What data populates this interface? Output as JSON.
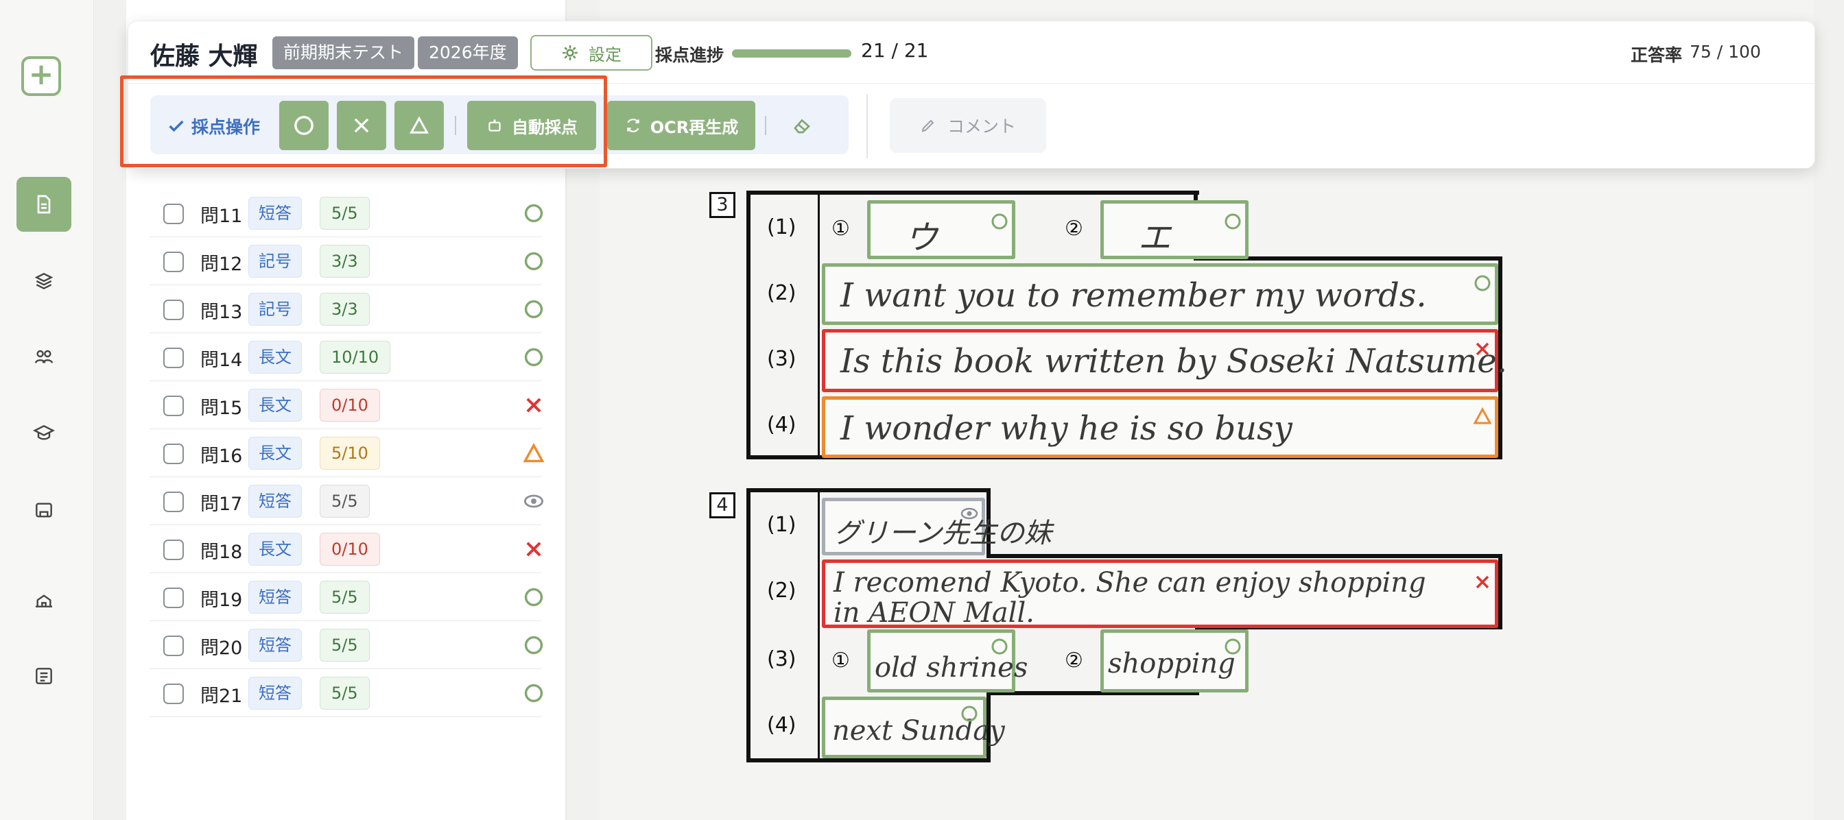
{
  "header": {
    "student_name": "佐藤 大輝",
    "exam_chip": "前期期末テスト",
    "year_chip": "2026年度",
    "settings_label": "設定",
    "progress_label": "採点進捗",
    "progress_value": "21 / 21",
    "progress_fraction": 1.0,
    "accuracy_label": "正答率",
    "accuracy_value": "75 / 100"
  },
  "toolbar": {
    "label": "採点操作",
    "auto_grade": "自動採点",
    "ocr_regen": "OCR再生成",
    "comment": "コメント"
  },
  "question_list": [
    {
      "num": "問11",
      "type": "短答",
      "score": "5/5",
      "status": "correct"
    },
    {
      "num": "問12",
      "type": "記号",
      "score": "3/3",
      "status": "correct"
    },
    {
      "num": "問13",
      "type": "記号",
      "score": "3/3",
      "status": "correct"
    },
    {
      "num": "問14",
      "type": "長文",
      "score": "10/10",
      "status": "correct"
    },
    {
      "num": "問15",
      "type": "長文",
      "score": "0/10",
      "status": "wrong"
    },
    {
      "num": "問16",
      "type": "長文",
      "score": "5/10",
      "status": "partial"
    },
    {
      "num": "問17",
      "type": "短答",
      "score": "5/5",
      "status": "unchecked"
    },
    {
      "num": "問18",
      "type": "長文",
      "score": "0/10",
      "status": "wrong"
    },
    {
      "num": "問19",
      "type": "短答",
      "score": "5/5",
      "status": "correct"
    },
    {
      "num": "問20",
      "type": "短答",
      "score": "5/5",
      "status": "correct"
    },
    {
      "num": "問21",
      "type": "短答",
      "score": "5/5",
      "status": "correct"
    }
  ],
  "sheet": {
    "section3": {
      "label": "3",
      "rows": [
        "(1)",
        "(2)",
        "(3)",
        "(4)"
      ],
      "sub1": "①",
      "sub2": "②",
      "ans_1a": "ウ",
      "ans_1b": "エ",
      "ans_2": "I want you to remember my words.",
      "ans_3": "Is this book written by Soseki Natsume.",
      "ans_4": "I wonder why he is so busy"
    },
    "section4": {
      "label": "4",
      "rows": [
        "(1)",
        "(2)",
        "(3)",
        "(4)"
      ],
      "sub1": "①",
      "sub2": "②",
      "ans_1": "グリーン先生の妹",
      "ans_2_line1": "I recomend Kyoto. She can enjoy shopping",
      "ans_2_line2": "in AEON Mall.",
      "ans_3a": "old shrines",
      "ans_3b": "shopping",
      "ans_4": "next Sunday"
    }
  },
  "colors": {
    "accent_green": "#8fb37f",
    "wrong_red": "#e0342f",
    "partial_orange": "#ef8a2d",
    "highlight_orange": "#e8582e",
    "link_blue": "#3d6fc2"
  }
}
